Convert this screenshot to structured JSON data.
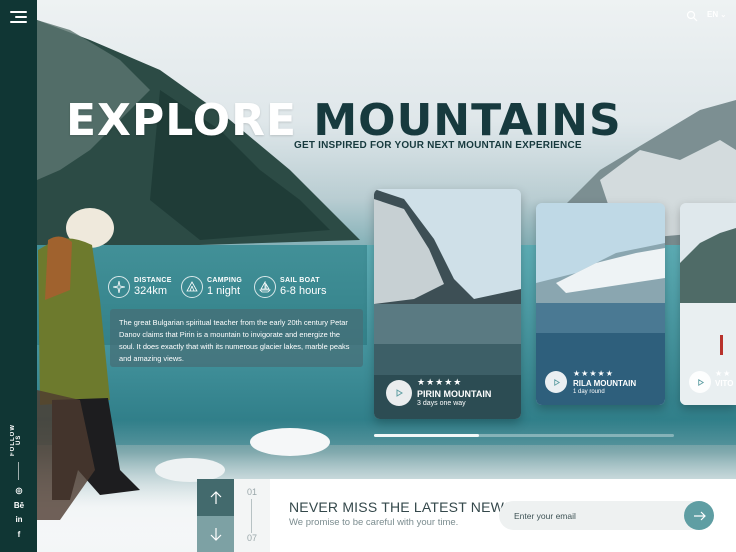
{
  "header": {
    "language": "EN",
    "menu_icon": "hamburger-icon",
    "search_icon": "search-icon"
  },
  "hero": {
    "title_word1": "EXPLORE",
    "title_word2": "MOUNTAINS",
    "subtitle": "GET INSPIRED FOR YOUR NEXT MOUNTAIN EXPERIENCE"
  },
  "stats": [
    {
      "label": "DISTANCE",
      "value": "324km",
      "icon": "compass-icon"
    },
    {
      "label": "CAMPING",
      "value": "1 night",
      "icon": "tent-icon"
    },
    {
      "label": "SAIL BOAT",
      "value": "6-8 hours",
      "icon": "sailboat-icon"
    }
  ],
  "description": "The great Bulgarian spiritual teacher from the early 20th century Petar Danov claims that Pirin is a mountain to invigorate and energize the soul. It does exactly that with its numerous glacier lakes, marble peaks and amazing views.",
  "cards": [
    {
      "name": "PIRIN MOUNTAIN",
      "duration": "3 days one way",
      "rating": 5
    },
    {
      "name": "RILA MOUNTAIN",
      "duration": "1 day round",
      "rating": 5
    },
    {
      "name": "VITO",
      "duration": "",
      "rating": 5
    }
  ],
  "carousel": {
    "progress": 0.35
  },
  "sidebar": {
    "follow_label": "FOLLOW US",
    "social": [
      {
        "icon": "dribbble-icon",
        "text": "◎"
      },
      {
        "icon": "behance-icon",
        "text": "Bē"
      },
      {
        "icon": "linkedin-icon",
        "text": "in"
      },
      {
        "icon": "facebook-icon",
        "text": "f"
      }
    ]
  },
  "pager": {
    "current": "01",
    "total": "07"
  },
  "newsletter": {
    "title": "NEVER MISS THE LATEST NEWS",
    "subtitle": "We promise to be careful with your time.",
    "placeholder": "Enter your email",
    "submit_icon": "arrow-right-icon"
  },
  "colors": {
    "sidebar": "#103634",
    "accent": "#5f9ea3",
    "title_dark": "#173a3e"
  }
}
